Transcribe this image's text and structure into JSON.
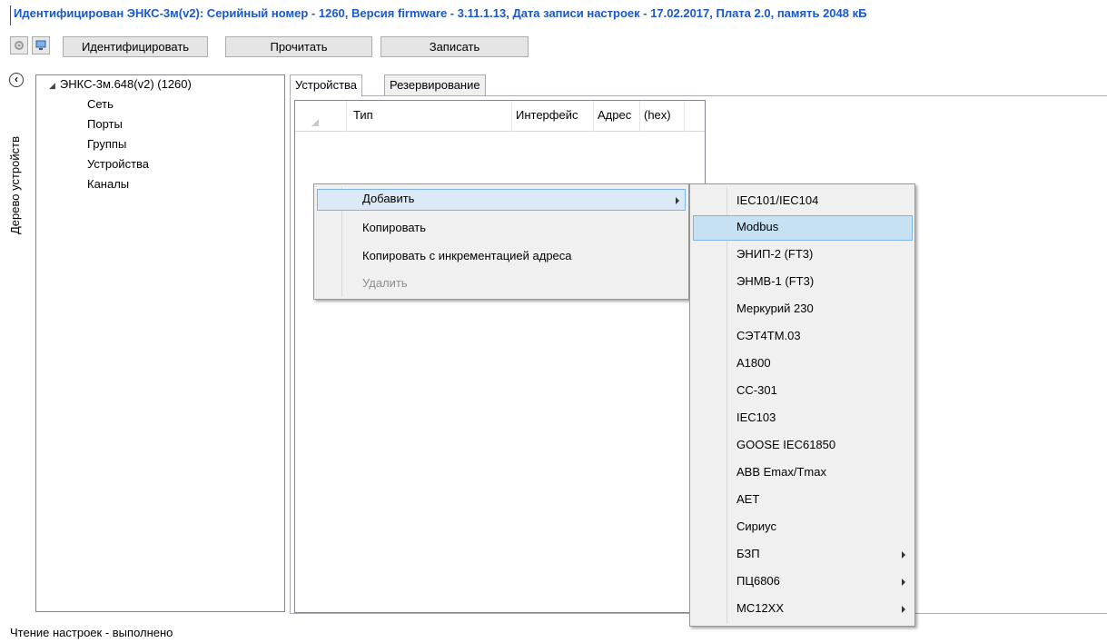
{
  "info": {
    "title": "Идентифицирован ЭНКС-3м(v2): Серийный номер - 1260, Версия firmware - 3.11.1.13, Дата записи настроек - 17.02.2017, Плата 2.0, память 2048 кБ"
  },
  "toolbar": {
    "settings_icon": "gear-icon",
    "device_icon": "monitor-icon",
    "identify_label": "Идентифицировать",
    "read_label": "Прочитать",
    "write_label": "Записать"
  },
  "sidebar": {
    "caption": "Дерево устройств",
    "toggle_icon": "chevron-left-icon"
  },
  "tree": {
    "root": "ЭНКС-3м.648(v2) (1260)",
    "items": [
      "Сеть",
      "Порты",
      "Группы",
      "Устройства",
      "Каналы"
    ]
  },
  "tabs": [
    {
      "label": "Устройства",
      "active": true
    },
    {
      "label": "Резервирование",
      "active": false
    }
  ],
  "grid": {
    "columns": [
      "Тип",
      "Интерфейс",
      "Адрес",
      "(hex)"
    ]
  },
  "context_menu": {
    "items": [
      {
        "label": "Добавить",
        "has_submenu": true,
        "highlighted": true,
        "enabled": true
      },
      {
        "label": "Копировать",
        "has_submenu": false,
        "highlighted": false,
        "enabled": true
      },
      {
        "label": "Копировать с инкрементацией адреса",
        "has_submenu": false,
        "highlighted": false,
        "enabled": true
      },
      {
        "label": "Удалить",
        "has_submenu": false,
        "highlighted": false,
        "enabled": false
      }
    ]
  },
  "submenu": {
    "items": [
      {
        "label": "IEC101/IEC104",
        "has_submenu": false
      },
      {
        "label": "Modbus",
        "has_submenu": false,
        "highlighted": true
      },
      {
        "label": "ЭНИП-2 (FT3)",
        "has_submenu": false
      },
      {
        "label": "ЭНМВ-1 (FT3)",
        "has_submenu": false
      },
      {
        "label": "Меркурий 230",
        "has_submenu": false
      },
      {
        "label": "СЭТ4ТМ.03",
        "has_submenu": false
      },
      {
        "label": "A1800",
        "has_submenu": false
      },
      {
        "label": "CC-301",
        "has_submenu": false
      },
      {
        "label": "IEC103",
        "has_submenu": false
      },
      {
        "label": "GOOSE IEC61850",
        "has_submenu": false
      },
      {
        "label": "ABB Emax/Tmax",
        "has_submenu": false
      },
      {
        "label": "AET",
        "has_submenu": false
      },
      {
        "label": "Сириус",
        "has_submenu": false
      },
      {
        "label": "БЗП",
        "has_submenu": true
      },
      {
        "label": "ПЦ6806",
        "has_submenu": true
      },
      {
        "label": "МС12ХХ",
        "has_submenu": true
      }
    ]
  },
  "status": {
    "text": "Чтение настроек - выполнено"
  },
  "colors": {
    "info_text": "#1a57c9",
    "highlight_bg": "#c6e2f2",
    "highlight_border": "#7eb4ea",
    "menu_bg": "#f0f0f0"
  }
}
